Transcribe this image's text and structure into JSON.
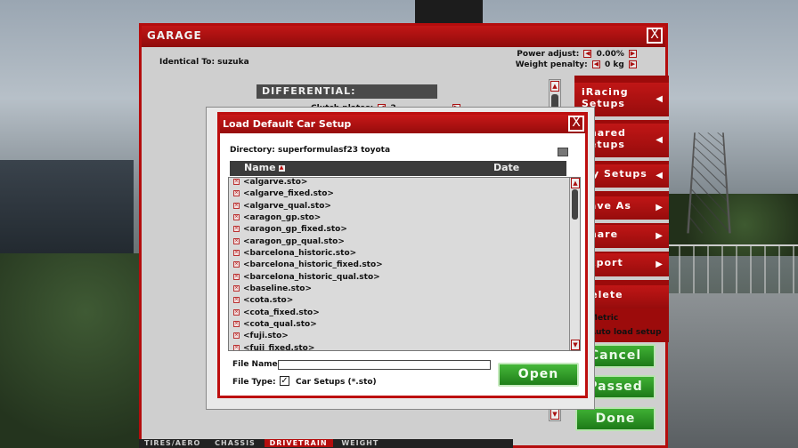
{
  "garage": {
    "title": "GARAGE",
    "close_label": "X",
    "identical_to": "Identical To: suzuka",
    "power_adjust_label": "Power adjust:",
    "power_adjust_value": "0.00%",
    "weight_penalty_label": "Weight penalty:",
    "weight_penalty_value": "0 kg",
    "section_header": "DIFFERENTIAL:",
    "clutch_plates_label": "Clutch plates:",
    "clutch_plates_value": "2"
  },
  "menu": {
    "items": [
      {
        "label": "iRacing Setups"
      },
      {
        "label": "Shared Setups"
      },
      {
        "label": "My Setups"
      },
      {
        "label": "Save As"
      },
      {
        "label": "Share"
      },
      {
        "label": "Export"
      },
      {
        "label": "Delete"
      }
    ],
    "metric_label": "Metric",
    "auto_load_label": "Auto load setup",
    "cancel_label": "Cancel",
    "passed_label": "Passed",
    "done_label": "Done"
  },
  "bottom_tabs": [
    "TIRES/AERO",
    "CHASSIS",
    "DRIVETRAIN",
    "WEIGHT"
  ],
  "dialog": {
    "title": "Load Default Car Setup",
    "close_label": "X",
    "directory": "Directory: superformulasf23 toyota",
    "col_name": "Name",
    "col_date": "Date",
    "files": [
      "<algarve.sto>",
      "<algarve_fixed.sto>",
      "<algarve_qual.sto>",
      "<aragon_gp.sto>",
      "<aragon_gp_fixed.sto>",
      "<aragon_gp_qual.sto>",
      "<barcelona_historic.sto>",
      "<barcelona_historic_fixed.sto>",
      "<barcelona_historic_qual.sto>",
      "<baseline.sto>",
      "<cota.sto>",
      "<cota_fixed.sto>",
      "<cota_qual.sto>",
      "<fuji.sto>",
      "<fuji_fixed.sto>"
    ],
    "file_name_label": "File Name:",
    "file_name_value": "",
    "file_type_label": "File Type:",
    "file_type_value": "Car Setups (*.sto)",
    "open_label": "Open"
  },
  "icons": {
    "file": "file-icon",
    "sort": "sort-icon",
    "checkbox": "checkbox-icon",
    "arrow": "chevron-left-icon"
  },
  "colors": {
    "accent_red": "#b40d0d",
    "button_green": "#2e9a27"
  }
}
